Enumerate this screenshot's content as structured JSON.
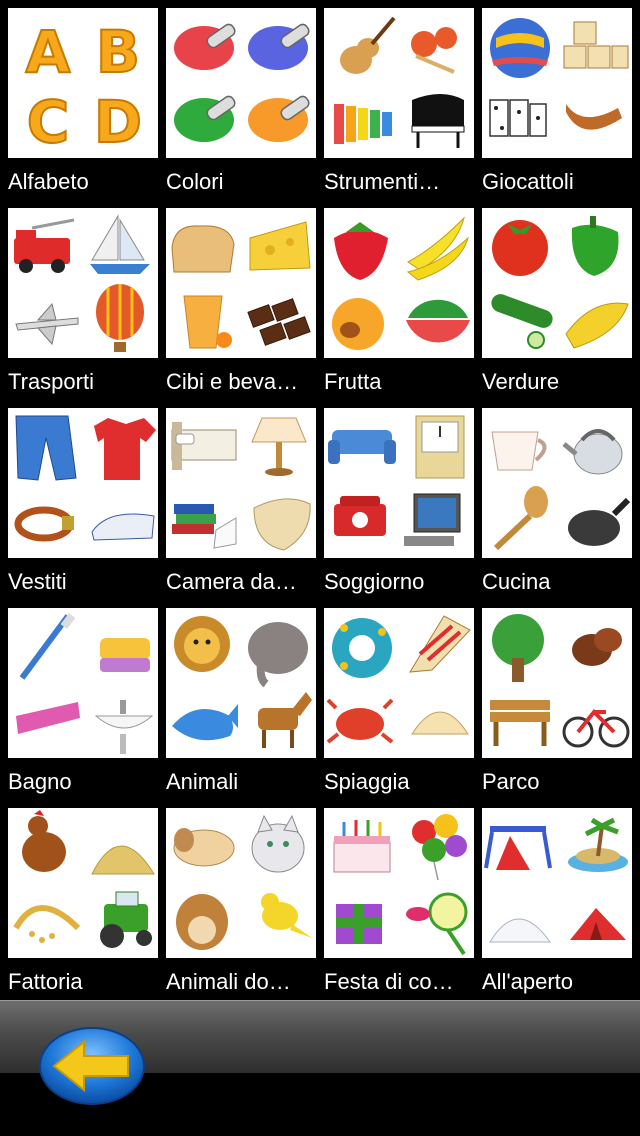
{
  "categories": [
    {
      "label": "Alfabeto",
      "icon": "alphabet-icon"
    },
    {
      "label": "Colori",
      "icon": "colors-icon"
    },
    {
      "label": "Strumenti…",
      "icon": "instruments-icon"
    },
    {
      "label": "Giocattoli",
      "icon": "toys-icon"
    },
    {
      "label": "Trasporti",
      "icon": "transport-icon"
    },
    {
      "label": "Cibi e beva…",
      "icon": "food-drinks-icon"
    },
    {
      "label": "Frutta",
      "icon": "fruit-icon"
    },
    {
      "label": "Verdure",
      "icon": "vegetables-icon"
    },
    {
      "label": "Vestiti",
      "icon": "clothes-icon"
    },
    {
      "label": "Camera da…",
      "icon": "bedroom-icon"
    },
    {
      "label": "Soggiorno",
      "icon": "living-room-icon"
    },
    {
      "label": "Cucina",
      "icon": "kitchen-icon"
    },
    {
      "label": "Bagno",
      "icon": "bathroom-icon"
    },
    {
      "label": "Animali",
      "icon": "animals-icon"
    },
    {
      "label": "Spiaggia",
      "icon": "beach-icon"
    },
    {
      "label": "Parco",
      "icon": "park-icon"
    },
    {
      "label": "Fattoria",
      "icon": "farm-icon"
    },
    {
      "label": "Animali do…",
      "icon": "pets-icon"
    },
    {
      "label": "Festa di co…",
      "icon": "birthday-party-icon"
    },
    {
      "label": "All'aperto",
      "icon": "outdoors-icon"
    }
  ],
  "alphabet_letters": [
    "A",
    "B",
    "C",
    "D"
  ],
  "toolbar": {
    "back_icon": "back-arrow-icon",
    "arrow_color": "#f4c81a",
    "button_color": "#1e78d8"
  }
}
